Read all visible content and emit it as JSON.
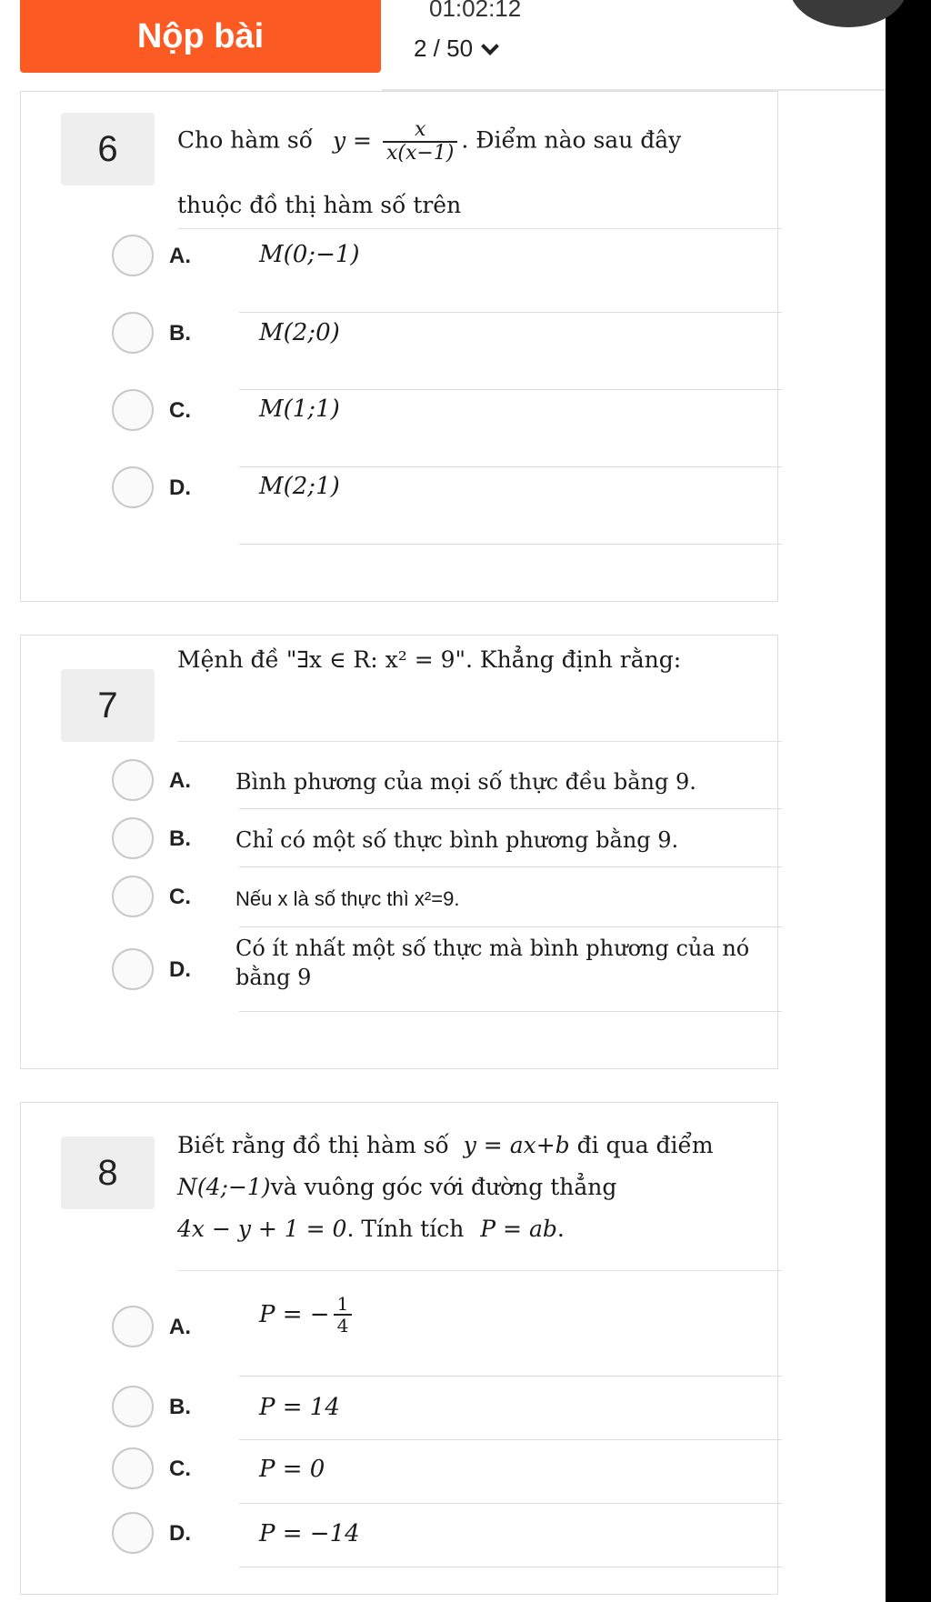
{
  "header": {
    "submit_label": "Nộp bài",
    "timer": "01:02:12",
    "page": "2 / 50"
  },
  "questions": [
    {
      "number": "6",
      "text_before": "Cho hàm số",
      "eq_prefix": "y =",
      "frac_num": "x",
      "frac_den": "x(x−1)",
      "text_after": ". Điểm nào sau đây",
      "text_line2": "thuộc đồ thị hàm số trên",
      "options": [
        {
          "letter": "A.",
          "text": "M(0;−1)"
        },
        {
          "letter": "B.",
          "text": "M(2;0)"
        },
        {
          "letter": "C.",
          "text": "M(1;1)"
        },
        {
          "letter": "D.",
          "text": "M(2;1)"
        }
      ]
    },
    {
      "number": "7",
      "text": "Mệnh đề \"∃x ∈ R: x² = 9\". Khẳng định rằng:",
      "options": [
        {
          "letter": "A.",
          "text": "Bình phương của mọi số thực đều bằng 9."
        },
        {
          "letter": "B.",
          "text": "Chỉ có một số thực bình phương bằng 9."
        },
        {
          "letter": "C.",
          "text": "Nếu x là số thực thì x²=9."
        },
        {
          "letter": "D.",
          "text_line1": "Có ít nhất một số thực mà bình phương của nó",
          "text_line2": "bằng 9"
        }
      ]
    },
    {
      "number": "8",
      "line1_a": "Biết rằng đồ thị hàm số",
      "line1_math": "y = ax+b",
      "line1_b": "đi qua điểm",
      "line2_math": "N(4;−1)",
      "line2_text": "và vuông góc với đường thẳng",
      "line3_math": "4x − y + 1 = 0",
      "line3_text": ". Tính tích",
      "line3_math2": "P = ab",
      "line3_end": ".",
      "options": [
        {
          "letter": "A.",
          "prefix": "P = −",
          "frac_num": "1",
          "frac_den": "4"
        },
        {
          "letter": "B.",
          "text": "P = 14"
        },
        {
          "letter": "C.",
          "text": "P = 0"
        },
        {
          "letter": "D.",
          "text": "P = −14"
        }
      ]
    }
  ]
}
